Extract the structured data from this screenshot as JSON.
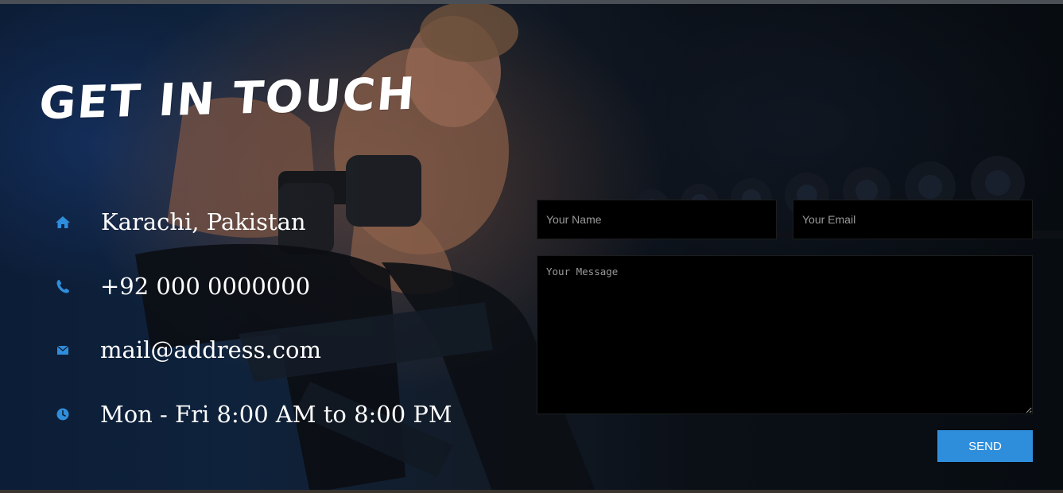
{
  "contact": {
    "heading": "GET IN TOUCH",
    "items": [
      {
        "icon": "home-icon",
        "text": "Karachi, Pakistan"
      },
      {
        "icon": "phone-icon",
        "text": "+92 000 0000000"
      },
      {
        "icon": "envelope-icon",
        "text": "mail@address.com"
      },
      {
        "icon": "clock-icon",
        "text": "Mon - Fri 8:00 AM to 8:00 PM"
      }
    ],
    "icon_color": "#2f8edc"
  },
  "form": {
    "name_placeholder": "Your Name",
    "email_placeholder": "Your Email",
    "message_placeholder": "Your Message",
    "send_label": "SEND",
    "button_color": "#2f8edc"
  }
}
